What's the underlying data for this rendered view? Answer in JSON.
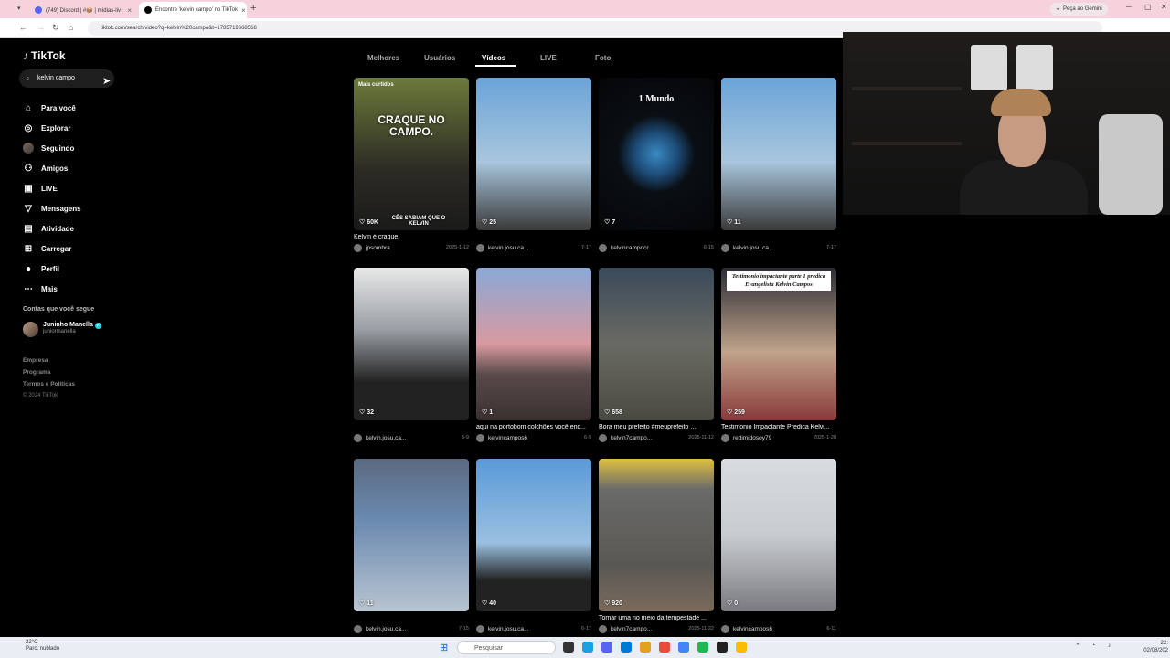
{
  "browser": {
    "tabs": [
      {
        "title": "(749) Discord | #📦 | mídias-liv"
      },
      {
        "title": "Encontre 'kelvin campo' no TikTok"
      }
    ],
    "new_tab": "+",
    "gemini": "Peça ao Gemini",
    "url": "tiktok.com/search/video?q=kelvin%20campo&t=1785719668568"
  },
  "tiktok": {
    "logo": "TikTok",
    "search": {
      "value": "kelvin campo"
    },
    "nav": [
      {
        "label": "Para você",
        "icon": "home-icon",
        "glyph": "⌂"
      },
      {
        "label": "Explorar",
        "icon": "compass-icon",
        "glyph": "◎"
      },
      {
        "label": "Seguindo",
        "icon": "avatar",
        "glyph": ""
      },
      {
        "label": "Amigos",
        "icon": "friends-icon",
        "glyph": "⚇"
      },
      {
        "label": "LIVE",
        "icon": "live-icon",
        "glyph": "▣"
      },
      {
        "label": "Mensagens",
        "icon": "send-icon",
        "glyph": "▽"
      },
      {
        "label": "Atividade",
        "icon": "activity-icon",
        "glyph": "▤"
      },
      {
        "label": "Carregar",
        "icon": "upload-icon",
        "glyph": "⊞"
      },
      {
        "label": "Perfil",
        "icon": "profile-icon",
        "glyph": "●"
      },
      {
        "label": "Mais",
        "icon": "more-icon",
        "glyph": "⋯"
      }
    ],
    "following_title": "Contas que você segue",
    "following_user": {
      "name": "Juninho Manella",
      "handle": "juniormanella"
    },
    "footer": [
      "Empresa",
      "Programa",
      "Termos e Políticas",
      "© 2024 TikTok"
    ],
    "search_tabs": [
      "Melhores",
      "Usuários",
      "Vídeos",
      "LIVE",
      "Foto"
    ],
    "active_tab": "Vídeos",
    "videos": [
      {
        "likes": "60K",
        "caption": "Kelvin é craque.",
        "user": "jpsombra",
        "date": "2025-1-12",
        "badge": "Mais curtidos",
        "overlay": "CRAQUE NO CAMPO.",
        "sub": "CÊS SABIAM QUE O KELVIN",
        "bg": "linear-gradient(180deg,#6c7a3a,#2d2b24 60%,#1a1a1a)"
      },
      {
        "likes": "25",
        "caption": "",
        "user": "kelvin.josu.ca...",
        "date": "7-17",
        "badge": "",
        "overlay": "",
        "sub": "",
        "bg": "linear-gradient(180deg,#6aa4d8,#a8c6dd 55%,#3a3a3a)"
      },
      {
        "likes": "7",
        "caption": "",
        "user": "kelvincampocr",
        "date": "6-15",
        "badge": "",
        "overlay": "1 Mundo",
        "sub": "",
        "bg": "radial-gradient(circle at 50% 50%,#3a8ac0 0,#1d4c78 22%,#0a0f14 40%,#050608 100%)"
      },
      {
        "likes": "11",
        "caption": "",
        "user": "kelvin.josu.ca...",
        "date": "7-17",
        "badge": "",
        "overlay": "",
        "sub": "",
        "bg": "linear-gradient(180deg,#6aa4d8,#a8c6dd 55%,#3a3a3a)"
      },
      {
        "likes": "32",
        "caption": "",
        "user": "kelvin.josu.ca...",
        "date": "5-9",
        "badge": "",
        "overlay": "",
        "sub": "",
        "bg": "linear-gradient(180deg,#e8e8e8,#9aa0a6 40%,#222 75%)"
      },
      {
        "likes": "1",
        "caption": "aqui na portobom colchões você enc...",
        "user": "kelvincampos6",
        "date": "6-9",
        "badge": "",
        "overlay": "",
        "sub": "",
        "bg": "linear-gradient(180deg,#8aa8d6,#d89aa0 50%,#5a4a4a 70%,#3a3030)"
      },
      {
        "likes": "658",
        "caption": "Bora meu prefeito #meuprefeito ...",
        "user": "kelvin7campo...",
        "date": "2025-11-12",
        "badge": "",
        "overlay": "",
        "sub": "",
        "bg": "linear-gradient(180deg,#3a4a5a,#6a6a64 50%,#4a4a42)"
      },
      {
        "likes": "259",
        "caption": "Testimonio Impactante Predica Kelvi...",
        "user": "redimidosoy79",
        "date": "2025-1-28",
        "badge": "",
        "overlay": "Testimonio impactante parte 1 predica Evangelista Kelvin Campos",
        "sub": "",
        "bg": "linear-gradient(180deg,#2a2c34,#c0a38a 55%,#8a3a3a)"
      },
      {
        "likes": "11",
        "caption": "",
        "user": "kelvin.josu.ca...",
        "date": "7-15",
        "badge": "",
        "overlay": "",
        "sub": "",
        "bg": "linear-gradient(180deg,#5a6a80,#6a8ab0 40%,#b8c4d0)"
      },
      {
        "likes": "40",
        "caption": "",
        "user": "kelvin.josu.ca...",
        "date": "6-17",
        "badge": "",
        "overlay": "",
        "sub": "",
        "bg": "linear-gradient(180deg,#5a9ad8,#9ac0e0 55%,#222 80%)"
      },
      {
        "likes": "920",
        "caption": "Tomar uma no meio da tempestade ...",
        "user": "kelvin7campo...",
        "date": "2025-11-22",
        "badge": "",
        "overlay": "",
        "sub": "",
        "bg": "linear-gradient(180deg,#e0c040,#6a6a68 20%,#5a5854 70%,#7a6a5a)"
      },
      {
        "likes": "0",
        "caption": "",
        "user": "kelvincampos6",
        "date": "6-11",
        "badge": "",
        "overlay": "",
        "sub": "",
        "bg": "linear-gradient(180deg,#d8dce0,#c8ccd0 50%,#7a7a80)"
      }
    ]
  },
  "taskbar": {
    "weather_temp": "22°C",
    "weather_desc": "Parc. nublado",
    "search": "Pesquisar",
    "time": "22:",
    "date": "02/08/202"
  },
  "colors": {
    "accent": "#fe2c55",
    "verified": "#20d5ec"
  }
}
